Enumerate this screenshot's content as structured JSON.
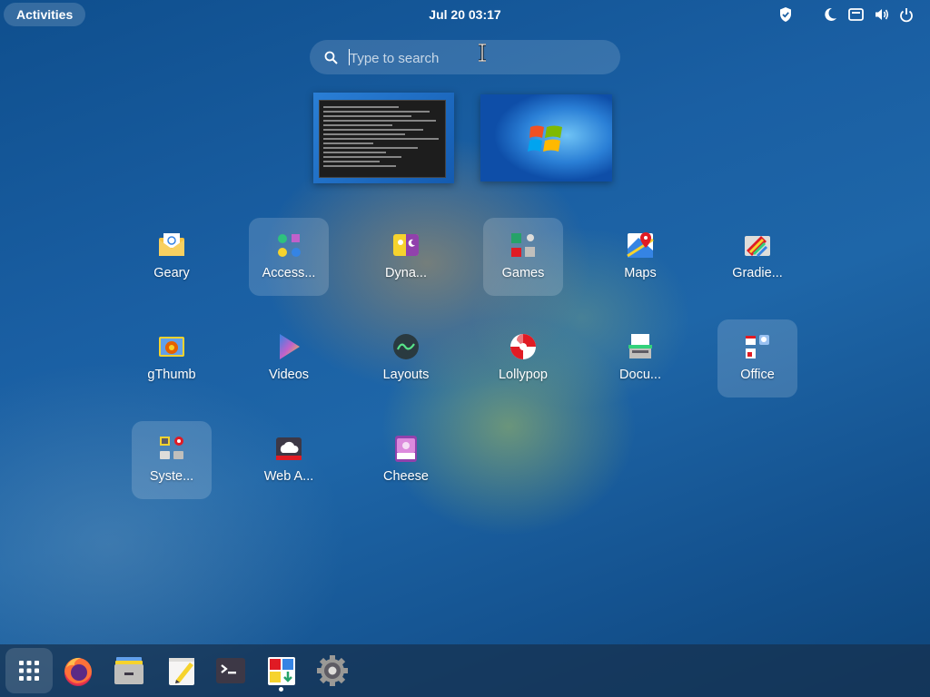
{
  "topbar": {
    "activities_label": "Activities",
    "clock": "Jul 20  03:17",
    "tray_icons": [
      "shield-icon",
      "night-light-icon",
      "keyboard-icon",
      "volume-icon",
      "power-icon"
    ]
  },
  "search": {
    "placeholder": "Type to search",
    "value": ""
  },
  "windows": [
    {
      "name": "terminal-window-preview"
    },
    {
      "name": "desktop-window-preview"
    }
  ],
  "apps": [
    {
      "label": "Geary",
      "icon": "mail-icon",
      "folder": false
    },
    {
      "label": "Access...",
      "icon": "accessibility-folder-icon",
      "folder": true
    },
    {
      "label": "Dyna...",
      "icon": "dynamic-wallpaper-icon",
      "folder": false
    },
    {
      "label": "Games",
      "icon": "games-folder-icon",
      "folder": true
    },
    {
      "label": "Maps",
      "icon": "maps-icon",
      "folder": false
    },
    {
      "label": "Gradie...",
      "icon": "gradience-icon",
      "folder": false
    },
    {
      "label": "gThumb",
      "icon": "gthumb-icon",
      "folder": false
    },
    {
      "label": "Videos",
      "icon": "videos-icon",
      "folder": false
    },
    {
      "label": "Layouts",
      "icon": "layouts-icon",
      "folder": false
    },
    {
      "label": "Lollypop",
      "icon": "lollypop-icon",
      "folder": false
    },
    {
      "label": "Docu...",
      "icon": "document-scanner-icon",
      "folder": false
    },
    {
      "label": "Office",
      "icon": "office-folder-icon",
      "folder": true
    },
    {
      "label": "Syste...",
      "icon": "system-folder-icon",
      "folder": true
    },
    {
      "label": "Web A...",
      "icon": "web-apps-icon",
      "folder": false
    },
    {
      "label": "Cheese",
      "icon": "cheese-icon",
      "folder": false
    }
  ],
  "dock": {
    "items": [
      "app-grid-icon",
      "firefox-icon",
      "files-icon",
      "text-editor-icon",
      "terminal-icon",
      "software-icon",
      "settings-icon"
    ],
    "running": "software-icon"
  },
  "colors": {
    "accent": "#3584e4",
    "panel": "#000000"
  }
}
